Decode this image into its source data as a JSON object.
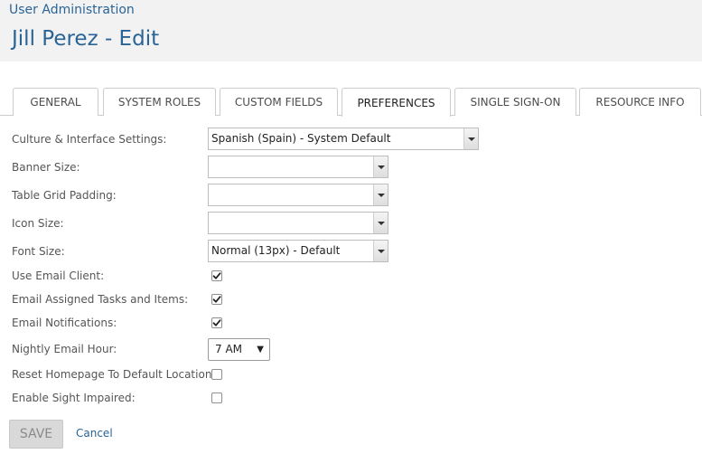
{
  "header": {
    "breadcrumb": "User Administration",
    "title": "Jill Perez - Edit"
  },
  "tabs": [
    {
      "label": "GENERAL",
      "active": false
    },
    {
      "label": "SYSTEM ROLES",
      "active": false
    },
    {
      "label": "CUSTOM FIELDS",
      "active": false
    },
    {
      "label": "PREFERENCES",
      "active": true
    },
    {
      "label": "SINGLE SIGN-ON",
      "active": false
    },
    {
      "label": "RESOURCE INFO",
      "active": false
    }
  ],
  "form": {
    "culture": {
      "label": "Culture & Interface Settings:",
      "value": "Spanish (Spain) - System Default"
    },
    "banner_size": {
      "label": "Banner Size:",
      "value": ""
    },
    "table_grid_padding": {
      "label": "Table Grid Padding:",
      "value": ""
    },
    "icon_size": {
      "label": "Icon Size:",
      "value": ""
    },
    "font_size": {
      "label": "Font Size:",
      "value": "Normal (13px) - Default"
    },
    "use_email_client": {
      "label": "Use Email Client:",
      "checked": true
    },
    "email_assigned_tasks": {
      "label": "Email Assigned Tasks and Items:",
      "checked": true
    },
    "email_notifications": {
      "label": "Email Notifications:",
      "checked": true
    },
    "nightly_email_hour": {
      "label": "Nightly Email Hour:",
      "value": "7 AM"
    },
    "reset_homepage": {
      "label": "Reset Homepage To Default Location:",
      "checked": false
    },
    "enable_sight_impaired": {
      "label": "Enable Sight Impaired:",
      "checked": false
    }
  },
  "actions": {
    "save_label": "SAVE",
    "cancel_label": "Cancel"
  },
  "colors": {
    "link_blue": "#2a6496",
    "header_bg": "#f2f2f2",
    "border": "#cccccc"
  }
}
